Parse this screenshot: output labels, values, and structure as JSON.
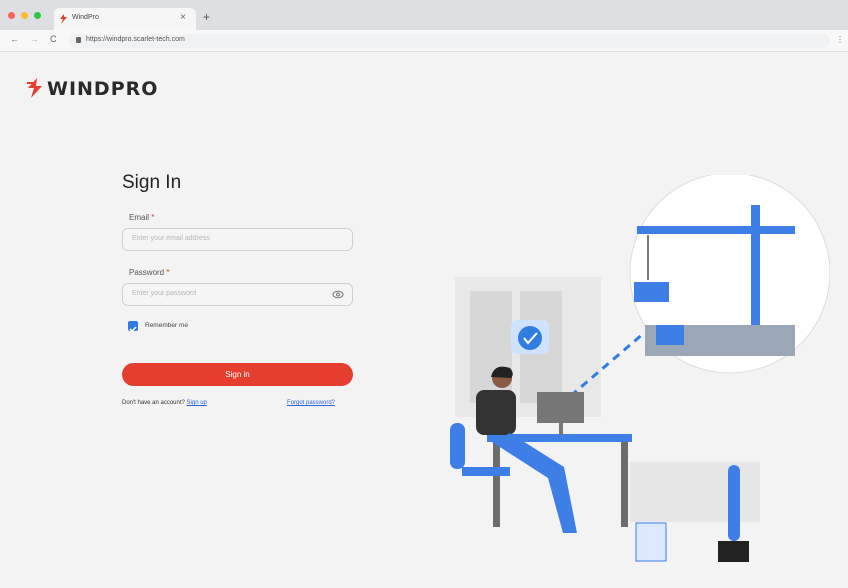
{
  "browser": {
    "tab_title": "WindPro",
    "url": "https://windpro.scarlet-tech.com",
    "traffic_colors": [
      "#ff5f57",
      "#febc2e",
      "#28c840"
    ]
  },
  "app": {
    "brand": "WINDPRO",
    "accent": "#e53e2f",
    "link_color": "#2f64d6"
  },
  "form": {
    "title": "Sign In",
    "email_label": "Email",
    "email_required": "*",
    "email_placeholder": "Enter your email address",
    "password_label": "Password",
    "password_required": "*",
    "password_placeholder": "Enter your password",
    "remember_label": "Remember me",
    "remember_checked": true,
    "signin_label": "Sign in",
    "no_account_text": "Don't have an account?",
    "signup_link": "Sign up",
    "forgot_link": "Forgot password?"
  },
  "icons": {
    "logo": "windpro-bolt-icon",
    "eye": "eye-icon",
    "check": "check-icon"
  }
}
